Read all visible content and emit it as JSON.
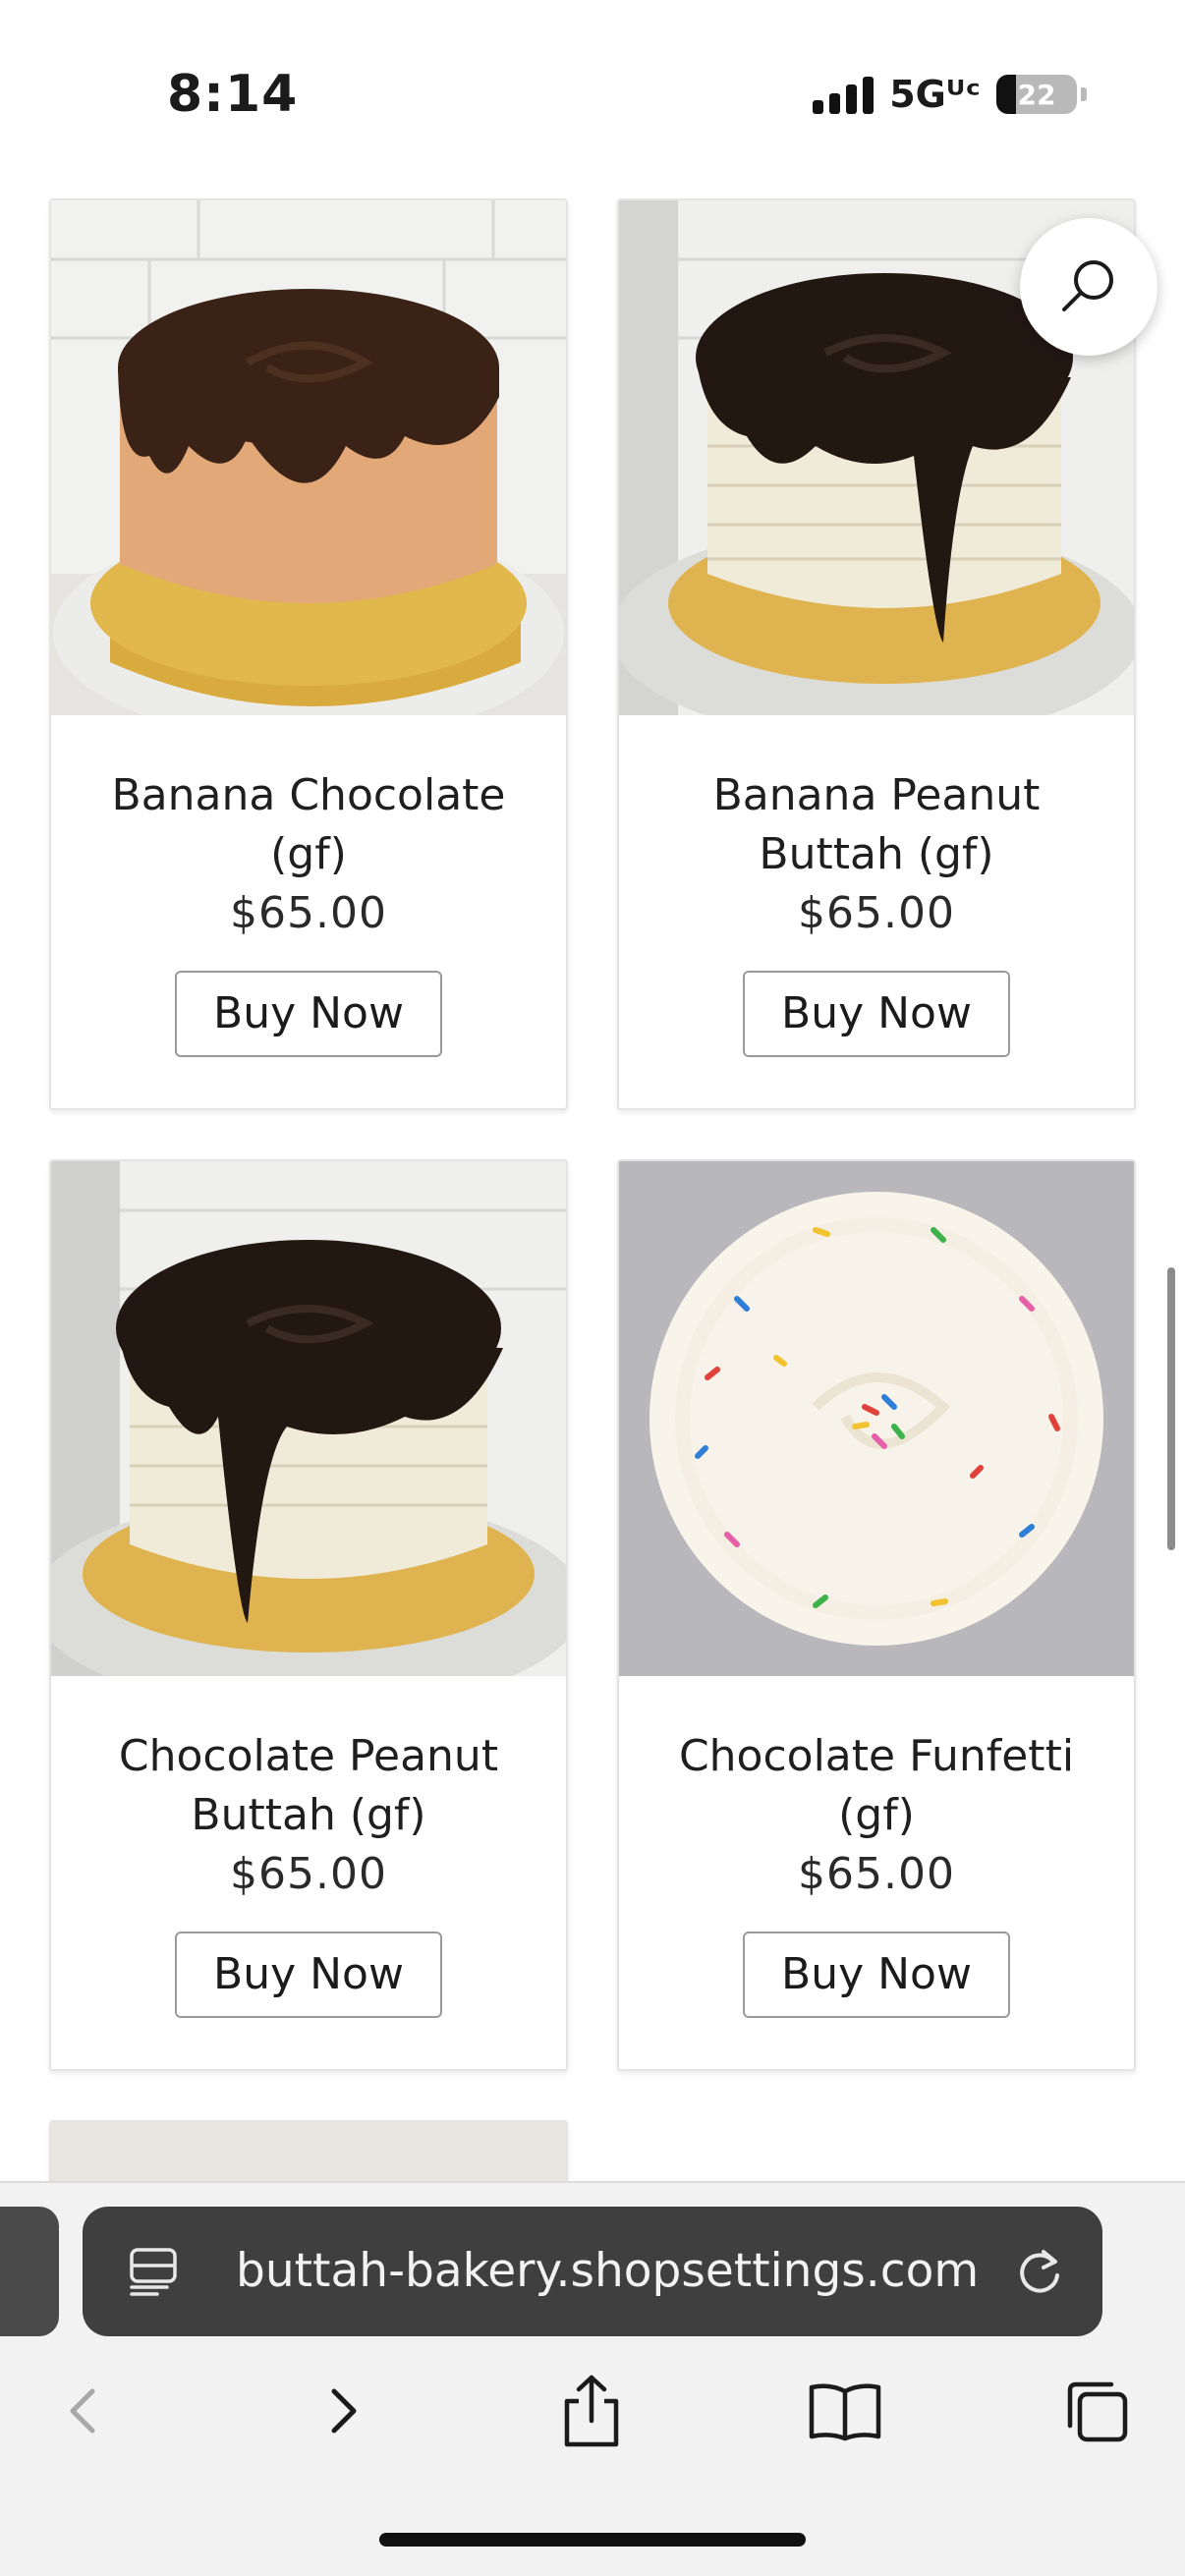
{
  "status_bar": {
    "time": "8:14",
    "network": "5Gᵁᶜ",
    "battery": "22"
  },
  "products": [
    {
      "name": "Banana Chocolate (gf)",
      "price": "$65.00",
      "button": "Buy Now",
      "image": "chocolate-drip-cake-peach-frosting"
    },
    {
      "name": "Banana Peanut Buttah (gf)",
      "price": "$65.00",
      "button": "Buy Now",
      "image": "chocolate-drip-cake-cream-frosting"
    },
    {
      "name": "Chocolate Peanut Buttah (gf)",
      "price": "$65.00",
      "button": "Buy Now",
      "image": "chocolate-drip-cake-cream-frosting"
    },
    {
      "name": "Chocolate Funfetti (gf)",
      "price": "$65.00",
      "button": "Buy Now",
      "image": "funfetti-cake-top-view"
    }
  ],
  "search": {
    "icon": "search-icon"
  },
  "browser": {
    "url": "buttah-bakery.shopsettings.com",
    "reader_icon": "reader-mode-icon",
    "reload_icon": "reload-icon",
    "nav": [
      "back-icon",
      "forward-icon",
      "share-icon",
      "bookmarks-icon",
      "tabs-icon"
    ]
  }
}
